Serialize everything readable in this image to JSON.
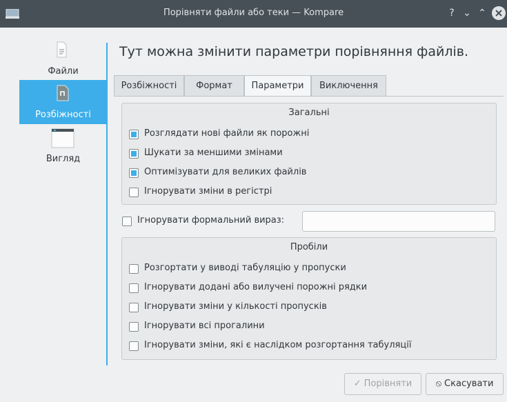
{
  "window": {
    "title": "Порівняти файли або теки — Kompare",
    "buttons": {
      "help": "?",
      "minimize": "⌄",
      "maximize": "⌃"
    }
  },
  "sidebar": {
    "items": [
      {
        "label": "Файли",
        "icon": "file-icon"
      },
      {
        "label": "Розбіжності",
        "icon": "diff-icon"
      },
      {
        "label": "Вигляд",
        "icon": "window-icon"
      }
    ]
  },
  "heading": "Тут можна змінити параметри порівняння файлів.",
  "tabs": [
    {
      "label": "Розбіжності"
    },
    {
      "label": "Формат"
    },
    {
      "label": "Параметри"
    },
    {
      "label": "Виключення"
    }
  ],
  "general": {
    "title": "Загальні",
    "options": [
      {
        "label": "Розглядати нові файли як порожні",
        "checked": true
      },
      {
        "label": "Шукати за меншими змінами",
        "checked": true
      },
      {
        "label": "Оптимізувати для великих файлів",
        "checked": true
      },
      {
        "label": "Ігнорувати зміни в регістрі",
        "checked": false
      }
    ]
  },
  "regex": {
    "label": "Ігнорувати формальний вираз:",
    "checked": false,
    "value": ""
  },
  "whitespace": {
    "title": "Пробіли",
    "options": [
      {
        "label": "Розгортати у виводі табуляцію у пропуски",
        "checked": false
      },
      {
        "label": "Ігнорувати додані або вилучені порожні рядки",
        "checked": false
      },
      {
        "label": "Ігнорувати зміни у кількості пропусків",
        "checked": false
      },
      {
        "label": "Ігнорувати всі прогалини",
        "checked": false
      },
      {
        "label": "Ігнорувати зміни, які є наслідком розгортання табуляції",
        "checked": false
      }
    ]
  },
  "footer": {
    "compare_label": "Порівняти",
    "compare_icon": "✓",
    "cancel_label": "Скасувати",
    "cancel_icon": "⦸"
  },
  "colors": {
    "accent": "#3daee9",
    "titlebar": "#475057"
  }
}
